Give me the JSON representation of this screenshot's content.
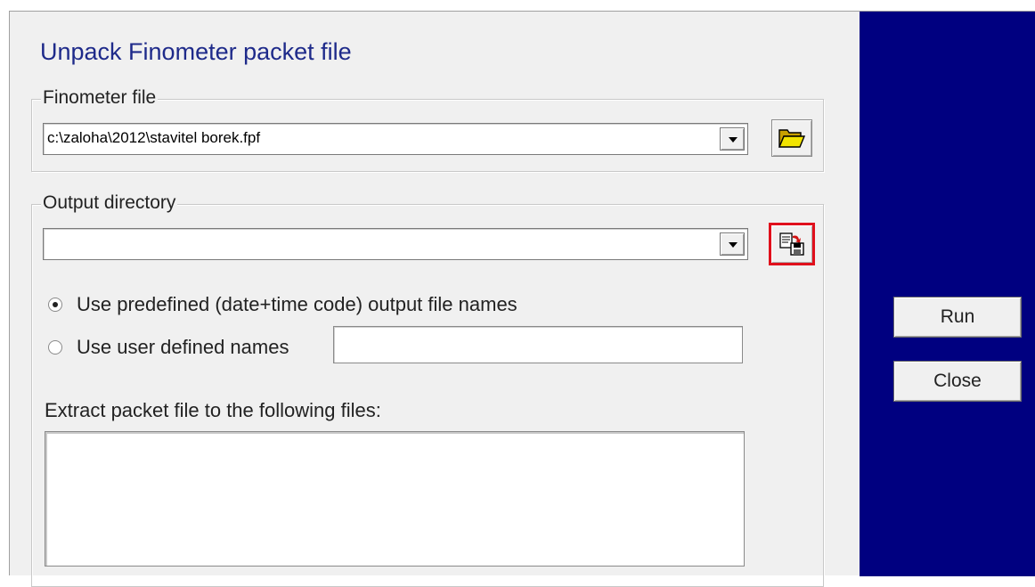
{
  "dialog": {
    "title": "Unpack Finometer packet file"
  },
  "finometer_file": {
    "legend": "Finometer file",
    "value": "c:\\zaloha\\2012\\stavitel borek.fpf",
    "browse_icon": "folder-open-icon"
  },
  "output_directory": {
    "legend": "Output directory",
    "value": "",
    "browse_icon": "save-to-folder-icon",
    "options": [
      {
        "label": "Use predefined (date+time code) output file names",
        "checked": true
      },
      {
        "label": "Use user defined names",
        "checked": false
      }
    ],
    "user_defined_name": "",
    "extract_label": "Extract packet file to the following files:",
    "extract_files": []
  },
  "actions": {
    "run_label": "Run",
    "close_label": "Close"
  },
  "colors": {
    "side_panel": "#000080",
    "title_text": "#1e2a8a",
    "focus_border": "#e0101c"
  }
}
